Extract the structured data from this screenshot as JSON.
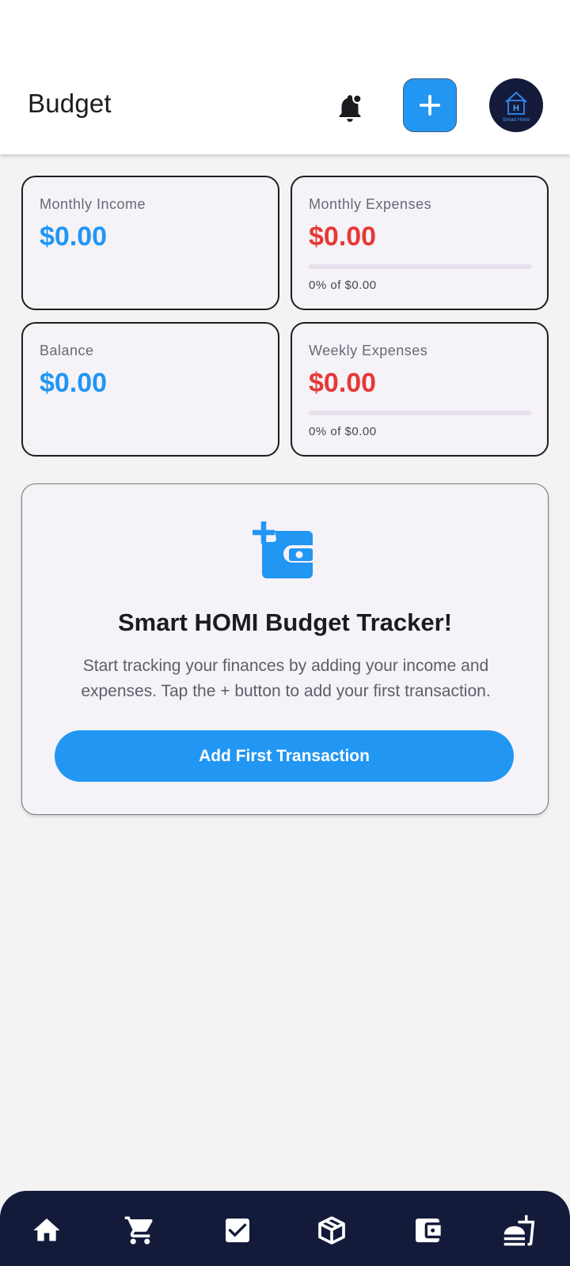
{
  "header": {
    "title": "Budget",
    "icons": {
      "notification": "notification-bell-icon",
      "add": "plus-icon",
      "avatar": "smart-homi-logo"
    },
    "avatar_caption": "Smart Homi"
  },
  "cards": {
    "monthly_income": {
      "label": "Monthly Income",
      "amount": "$0.00"
    },
    "monthly_expenses": {
      "label": "Monthly Expenses",
      "amount": "$0.00",
      "progress_text": "0% of $0.00",
      "progress_fraction": 0
    },
    "balance": {
      "label": "Balance",
      "amount": "$0.00"
    },
    "weekly_expenses": {
      "label": "Weekly Expenses",
      "amount": "$0.00",
      "progress_text": "0% of $0.00",
      "progress_fraction": 0
    }
  },
  "welcome": {
    "icon": "add-wallet-icon",
    "title": "Smart HOMI Budget Tracker!",
    "description": "Start tracking your finances by adding your income and expenses. Tap the + button to add your first transaction.",
    "button_label": "Add First Transaction"
  },
  "bottom_nav": {
    "items": [
      "home-icon",
      "shopping-cart-icon",
      "checkbox-icon",
      "box-icon",
      "wallet-icon",
      "food-icon"
    ]
  },
  "colors": {
    "accent": "#2196f3",
    "expense": "#e53935",
    "nav_background": "#141a3a",
    "card_background": "#f5f2f8"
  }
}
